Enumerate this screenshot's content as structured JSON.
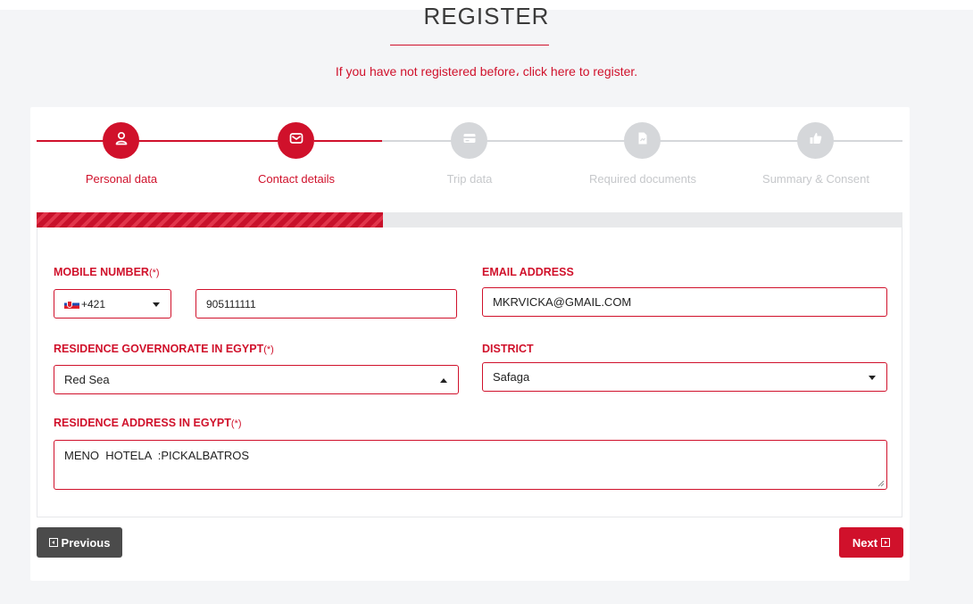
{
  "page": {
    "heading": "REGISTER",
    "register_prompt": "If you have not registered before، click here to register."
  },
  "steps": [
    {
      "label": "Personal data",
      "icon": "user-icon",
      "state": "completed"
    },
    {
      "label": "Contact details",
      "icon": "envelope-icon",
      "state": "current"
    },
    {
      "label": "Trip data",
      "icon": "card-icon",
      "state": "pending"
    },
    {
      "label": "Required documents",
      "icon": "document-icon",
      "state": "pending"
    },
    {
      "label": "Summary & Consent",
      "icon": "thumbs-up-icon",
      "state": "pending"
    }
  ],
  "progress": {
    "fraction": 0.4
  },
  "form": {
    "mobile_label": "MOBILE NUMBER",
    "required_mark": "(*)",
    "country_code": "+421",
    "country_flag": "slovakia-flag-icon",
    "mobile_value": "905111111",
    "email_label": "EMAIL ADDRESS",
    "email_value": "MKRVICKA@GMAIL.COM",
    "governorate_label": "RESIDENCE GOVERNORATE IN EGYPT",
    "governorate_value": "Red Sea",
    "district_label": "DISTRICT",
    "district_value": "Safaga",
    "address_label": "RESIDENCE ADDRESS IN EGYPT",
    "address_value": "MENO  HOTELA  :PICKALBATROS"
  },
  "buttons": {
    "previous": "Previous",
    "next": "Next"
  },
  "colors": {
    "accent": "#d0112b",
    "inactive": "#d5d7da",
    "prev_button": "#4b4b4b"
  }
}
